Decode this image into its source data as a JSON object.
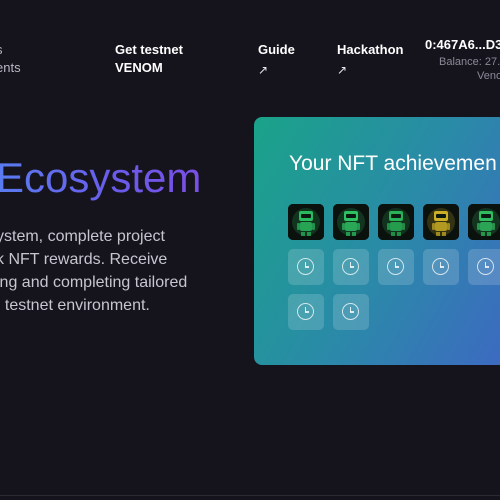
{
  "nav": {
    "left_line1": "s",
    "left_line2": "ents",
    "testnet_line1": "Get testnet",
    "testnet_line2": "VENOM",
    "guide": "Guide",
    "hackathon": "Hackathon",
    "external_arrow": "↗"
  },
  "wallet": {
    "address": "0:467A6...D3",
    "balance": "Balance: 27.",
    "currency": "Veno"
  },
  "hero": {
    "title": "Ecosystem",
    "lines": [
      "ystem, complete project",
      "k NFT rewards. Receive",
      "ing and completing tailored",
      ": testnet environment."
    ]
  },
  "card": {
    "title": "Your NFT achievemen",
    "nfts": [
      {
        "name": "nft-1",
        "accent": "#2fd36a"
      },
      {
        "name": "nft-2",
        "accent": "#34d96f"
      },
      {
        "name": "nft-3",
        "accent": "#2ec862"
      },
      {
        "name": "nft-4",
        "accent": "#e8c52a"
      },
      {
        "name": "nft-5",
        "accent": "#36d46c"
      }
    ],
    "locked_count": 7
  },
  "colors": {
    "background": "#15141c",
    "card_gradient_start": "#1aa389",
    "card_gradient_end": "#3f66c4",
    "title_gradient": "#5a7cf0"
  }
}
